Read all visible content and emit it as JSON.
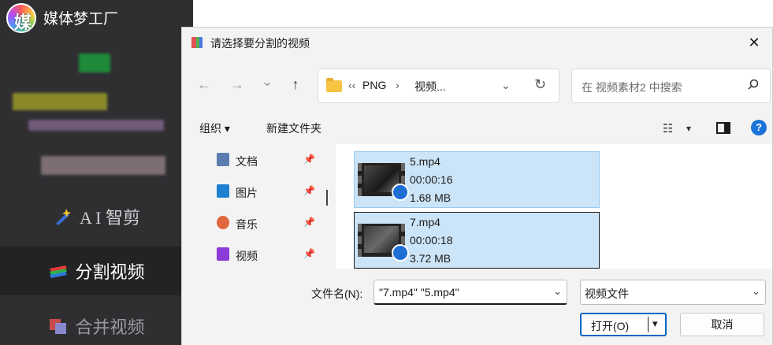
{
  "app": {
    "logo_char": "媒",
    "name": "媒体梦工厂",
    "nav": {
      "ai_label": "A I 智剪",
      "split_label": "分割视频",
      "merge_label": "合并视频"
    }
  },
  "dialog": {
    "title": "请选择要分割的视频",
    "close_glyph": "✕",
    "nav": {
      "back": "←",
      "forward": "→",
      "recent": "⌄",
      "up": "↑"
    },
    "address": {
      "prefix": "‹‹",
      "crumbs": [
        "PNG",
        "视频..."
      ],
      "separator": "›",
      "dropdown": "⌄",
      "refresh": "↻"
    },
    "search": {
      "placeholder": "在 视频素材2 中搜索"
    },
    "toolbar": {
      "organize": "组织 ▾",
      "new_folder": "新建文件夹",
      "view_glyph": "☷",
      "view_dd": "▾",
      "help": "?"
    },
    "quick_access": [
      {
        "label": "文档",
        "icon": "document-icon",
        "color": "#5b7db1",
        "pin": "📌"
      },
      {
        "label": "图片",
        "icon": "pictures-icon",
        "color": "#1e7fd0",
        "pin": "📌"
      },
      {
        "label": "音乐",
        "icon": "music-icon",
        "color": "#e0663c",
        "pin": "📌"
      },
      {
        "label": "视频",
        "icon": "videos-icon",
        "color": "#8a3ad6",
        "pin": "📌"
      }
    ],
    "files": [
      {
        "name": "5.mp4",
        "duration": "00:00:16",
        "size": "1.68 MB"
      },
      {
        "name": "7.mp4",
        "duration": "00:00:18",
        "size": "3.72 MB"
      }
    ],
    "footer": {
      "filename_label": "文件名(N):",
      "filename_value": "\"7.mp4\" \"5.mp4\"",
      "filename_dd": "⌄",
      "filetype_value": "视频文件",
      "filetype_dd": "⌄",
      "open_label": "打开(O)",
      "open_dd": "▾",
      "cancel_label": "取消"
    }
  },
  "colors": {
    "sidebar_bg": "#2f2f32",
    "selection": "#cce4f7",
    "accent": "#0067c0"
  }
}
